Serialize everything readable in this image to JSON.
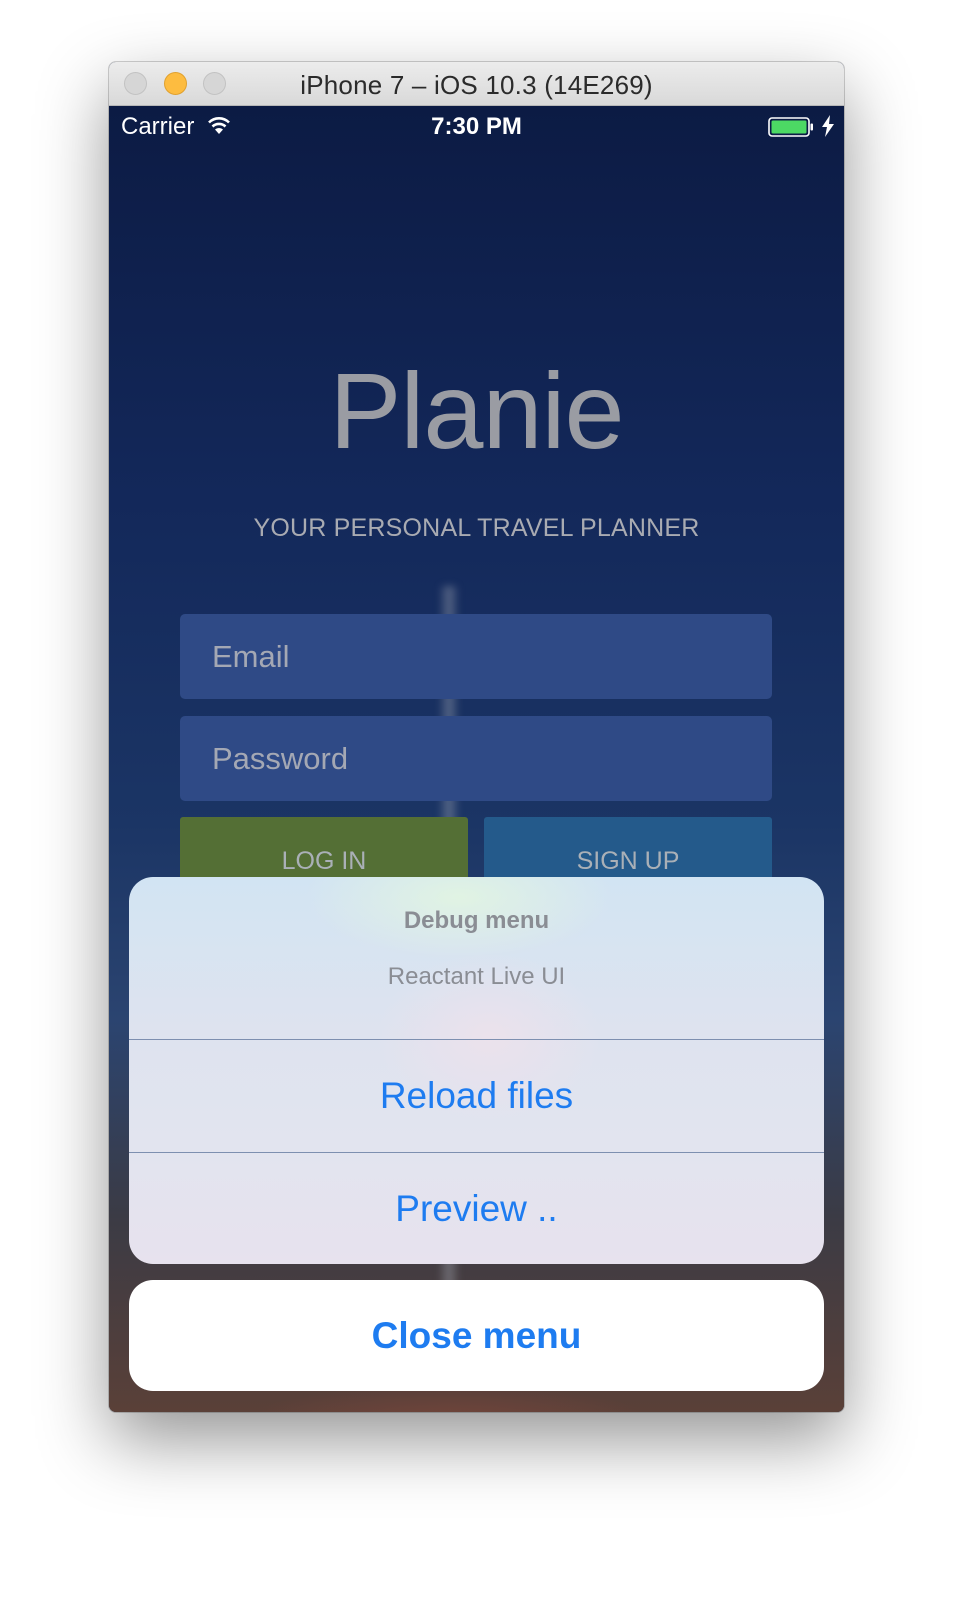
{
  "window": {
    "title": "iPhone 7 – iOS 10.3 (14E269)"
  },
  "status_bar": {
    "carrier": "Carrier",
    "time": "7:30 PM",
    "icons": [
      "wifi-icon",
      "battery-icon",
      "charging-bolt-icon"
    ]
  },
  "app": {
    "name": "Planie",
    "tagline": "YOUR PERSONAL TRAVEL PLANNER",
    "email_placeholder": "Email",
    "password_placeholder": "Password",
    "login_label": "LOG IN",
    "signup_label": "SIGN UP",
    "colors": {
      "login_button": "#546f35",
      "signup_button": "#245a8b",
      "input_background": "#2f4a86"
    }
  },
  "action_sheet": {
    "title": "Debug menu",
    "message": "Reactant Live UI",
    "actions": [
      {
        "label": "Reload files"
      },
      {
        "label": "Preview .."
      }
    ],
    "cancel_label": "Close menu",
    "accent_color": "#1e7cf0"
  }
}
